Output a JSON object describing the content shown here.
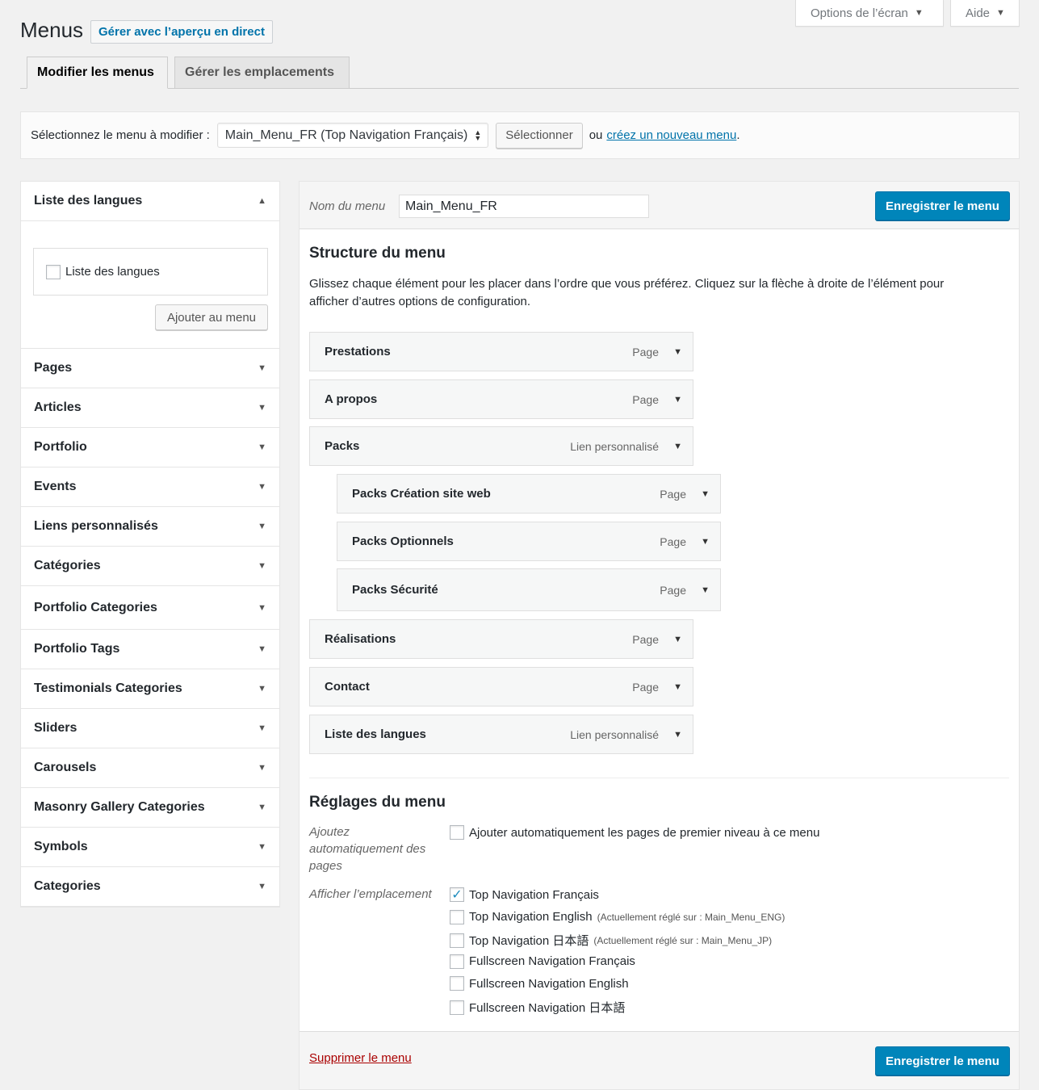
{
  "screen_meta": {
    "options_label": "Options de l’écran",
    "help_label": "Aide"
  },
  "header": {
    "title": "Menus",
    "live_preview_label": "Gérer avec l’aperçu en direct"
  },
  "tabs": [
    {
      "label": "Modifier les menus",
      "active": true
    },
    {
      "label": "Gérer les emplacements",
      "active": false
    }
  ],
  "select_menu": {
    "label": "Sélectionnez le menu à modifier :",
    "selected": "Main_Menu_FR (Top Navigation Français)",
    "select_button": "Sélectionner",
    "or_text": "ou",
    "create_link": "créez un nouveau menu",
    "period": "."
  },
  "sidebar": {
    "open_section": {
      "title": "Liste des langues",
      "checkbox_label": "Liste des langues",
      "add_button": "Ajouter au menu"
    },
    "sections": [
      "Pages",
      "Articles",
      "Portfolio",
      "Events",
      "Liens personnalisés",
      "Catégories",
      "Portfolio Categories",
      "Portfolio Tags",
      "Testimonials Categories",
      "Sliders",
      "Carousels",
      "Masonry Gallery Categories",
      "Symbols",
      "Categories"
    ]
  },
  "editor": {
    "name_label": "Nom du menu",
    "name_value": "Main_Menu_FR",
    "save_label": "Enregistrer le menu",
    "structure_title": "Structure du menu",
    "structure_desc_1": "Glissez chaque élément pour les placer dans l’ordre que vous préférez. Cliquez sur la flèche à droite de l’élément pour",
    "structure_desc_2": "afficher d’autres options de configuration.",
    "items": [
      {
        "title": "Prestations",
        "type": "Page",
        "depth": 0
      },
      {
        "title": "A propos",
        "type": "Page",
        "depth": 0
      },
      {
        "title": "Packs",
        "type": "Lien personnalisé",
        "depth": 0
      },
      {
        "title": "Packs Création site web",
        "type": "Page",
        "depth": 1
      },
      {
        "title": "Packs Optionnels",
        "type": "Page",
        "depth": 1
      },
      {
        "title": "Packs Sécurité",
        "type": "Page",
        "depth": 1
      },
      {
        "title": "Réalisations",
        "type": "Page",
        "depth": 0
      },
      {
        "title": "Contact",
        "type": "Page",
        "depth": 0
      },
      {
        "title": "Liste des langues",
        "type": "Lien personnalisé",
        "depth": 0
      }
    ],
    "settings_title": "Réglages du menu",
    "auto_add_label_1": "Ajoutez",
    "auto_add_label_2": "automatiquement des",
    "auto_add_label_3": "pages",
    "auto_add_option": "Ajouter automatiquement les pages de premier niveau à ce menu",
    "location_label": "Afficher l’emplacement",
    "locations": [
      {
        "label": "Top Navigation Français",
        "note": "",
        "checked": true
      },
      {
        "label": "Top Navigation English",
        "note": "(Actuellement réglé sur : Main_Menu_ENG)",
        "checked": false
      },
      {
        "label": "Top Navigation 日本語",
        "note": "(Actuellement réglé sur : Main_Menu_JP)",
        "checked": false
      },
      {
        "label": "Fullscreen Navigation Français",
        "note": "",
        "checked": false
      },
      {
        "label": "Fullscreen Navigation English",
        "note": "",
        "checked": false
      },
      {
        "label": "Fullscreen Navigation 日本語",
        "note": "",
        "checked": false
      }
    ],
    "delete_label": "Supprimer le menu"
  },
  "colors": {
    "accent": "#0085ba",
    "link": "#0073aa",
    "delete": "#a00",
    "background": "#f1f1f1"
  },
  "icons": {
    "collapse": "triangle-up-icon",
    "expand": "triangle-down-icon",
    "check": "checkmark-icon"
  }
}
